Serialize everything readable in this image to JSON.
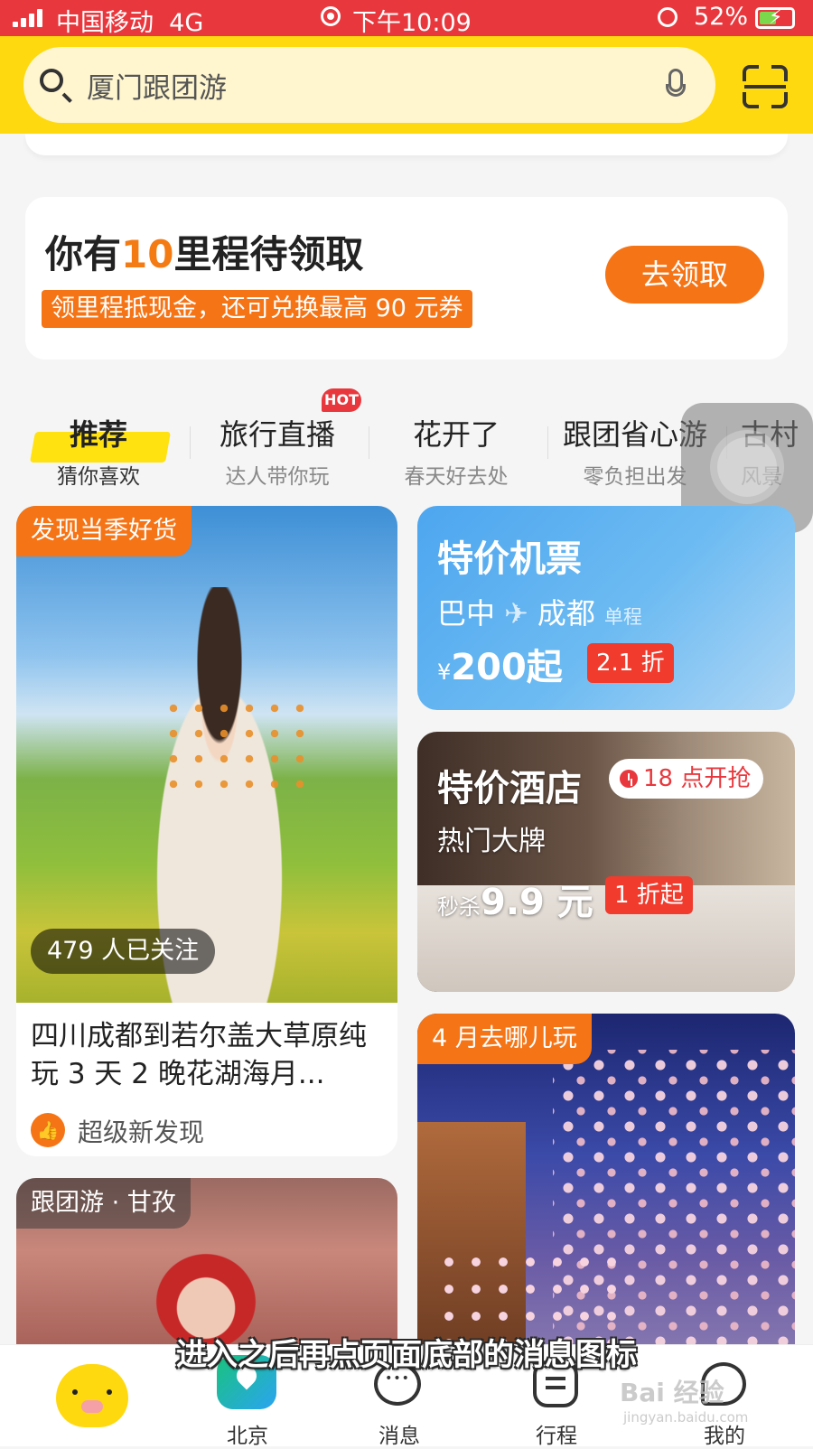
{
  "status_bar": {
    "carrier": "中国移动",
    "network": "4G",
    "time": "下午10:09",
    "battery": "52%",
    "battery_level": 0.52
  },
  "search": {
    "text": "厦门跟团游"
  },
  "miles_card": {
    "title_pre": "你有",
    "title_num": "10",
    "title_post": "里程待领取",
    "subtitle": "领里程抵现金，还可兑换最高 90 元券",
    "button": "去领取"
  },
  "tabs": [
    {
      "title": "推荐",
      "sub": "猜你喜欢"
    },
    {
      "title": "旅行直播",
      "sub": "达人带你玩"
    },
    {
      "title": "花开了",
      "sub": "春天好去处"
    },
    {
      "title": "跟团省心游",
      "sub": "零负担出发"
    },
    {
      "title": "古村",
      "sub": "风景"
    }
  ],
  "hot_badge": "HOT",
  "feed": {
    "card1": {
      "tag": "发现当季好货",
      "followers": "479 人已关注",
      "title": "四川成都到若尔盖大草原纯玩 3 天 2 晚花湖海月...",
      "source": "超级新发现"
    },
    "card3": {
      "tag": "跟团游 · 甘孜"
    },
    "flight": {
      "title": "特价机票",
      "from": "巴中",
      "to": "成都",
      "type": "单程",
      "currency": "¥",
      "price": "200起",
      "discount": "2.1 折"
    },
    "hotel": {
      "title": "特价酒店",
      "flash": "18 点开抢",
      "sub": "热门大牌",
      "price_pre": "秒杀",
      "price": "9.9 元",
      "discount": "1 折起"
    },
    "april": {
      "tag": "4 月去哪儿玩"
    }
  },
  "bottom_nav": [
    {
      "label": ""
    },
    {
      "label": "北京"
    },
    {
      "label": "消息"
    },
    {
      "label": "行程"
    },
    {
      "label": "我的"
    }
  ],
  "subtitle_overlay": "进入之后再点页面底部的消息图标",
  "watermark": {
    "main": "Bai 经验",
    "sub": "jingyan.baidu.com"
  },
  "colors": {
    "status_red": "#e8383d",
    "brand_yellow": "#ffd90f",
    "accent_orange": "#f57416",
    "flight_blue": "#4da6ef"
  }
}
